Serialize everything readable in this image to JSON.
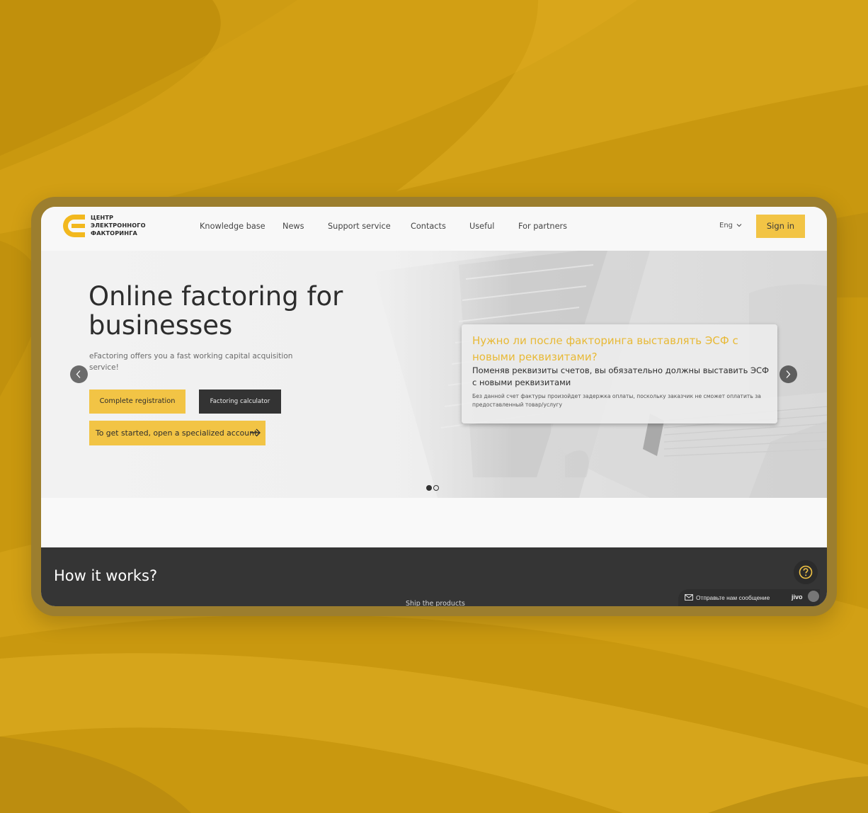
{
  "colors": {
    "background": "#c9980f",
    "accent": "#f2c445",
    "dark": "#353535",
    "card_title": "#e8b936"
  },
  "logo": {
    "icon": "efactoring-logo-icon",
    "line1": "ЦЕНТР",
    "line2": "ЭЛЕКТРОННОГО",
    "line3": "ФАКТОРИНГА"
  },
  "nav": {
    "items": [
      "Knowledge base",
      "News",
      "Support service",
      "Contacts",
      "Useful",
      "For partners"
    ]
  },
  "header": {
    "language": "Eng",
    "language_icon": "chevron-down-icon",
    "sign_in": "Sign in"
  },
  "hero": {
    "title": "Online factoring for businesses",
    "subtitle": "eFactoring offers you a fast working capital acquisition service!",
    "btn_registration": "Complete registration",
    "btn_calculator": "Factoring calculator",
    "btn_account": "To get started, open a specialized account",
    "btn_account_icon": "arrow-right-icon",
    "prev_icon": "chevron-left-icon",
    "next_icon": "chevron-right-icon",
    "slides_total": 2,
    "slide_active": 1
  },
  "card": {
    "title": "Нужно ли после факторинга выставлять ЭСФ с новыми реквизитами?",
    "body": "Поменяв реквизиты счетов, вы обязательно должны выставить ЭСФ с новыми реквизитами",
    "note": "Без данной счет фактуры произойдет задержка оплаты, поскольку заказчик не сможет оплатить за предоставленный товар/услугу"
  },
  "how": {
    "title": "How it works?",
    "step_label": "Ship the products",
    "help_icon": "question-circle-icon"
  },
  "chat": {
    "icon": "envelope-icon",
    "text": "Отправьте нам сообщение",
    "brand": "jivo"
  }
}
